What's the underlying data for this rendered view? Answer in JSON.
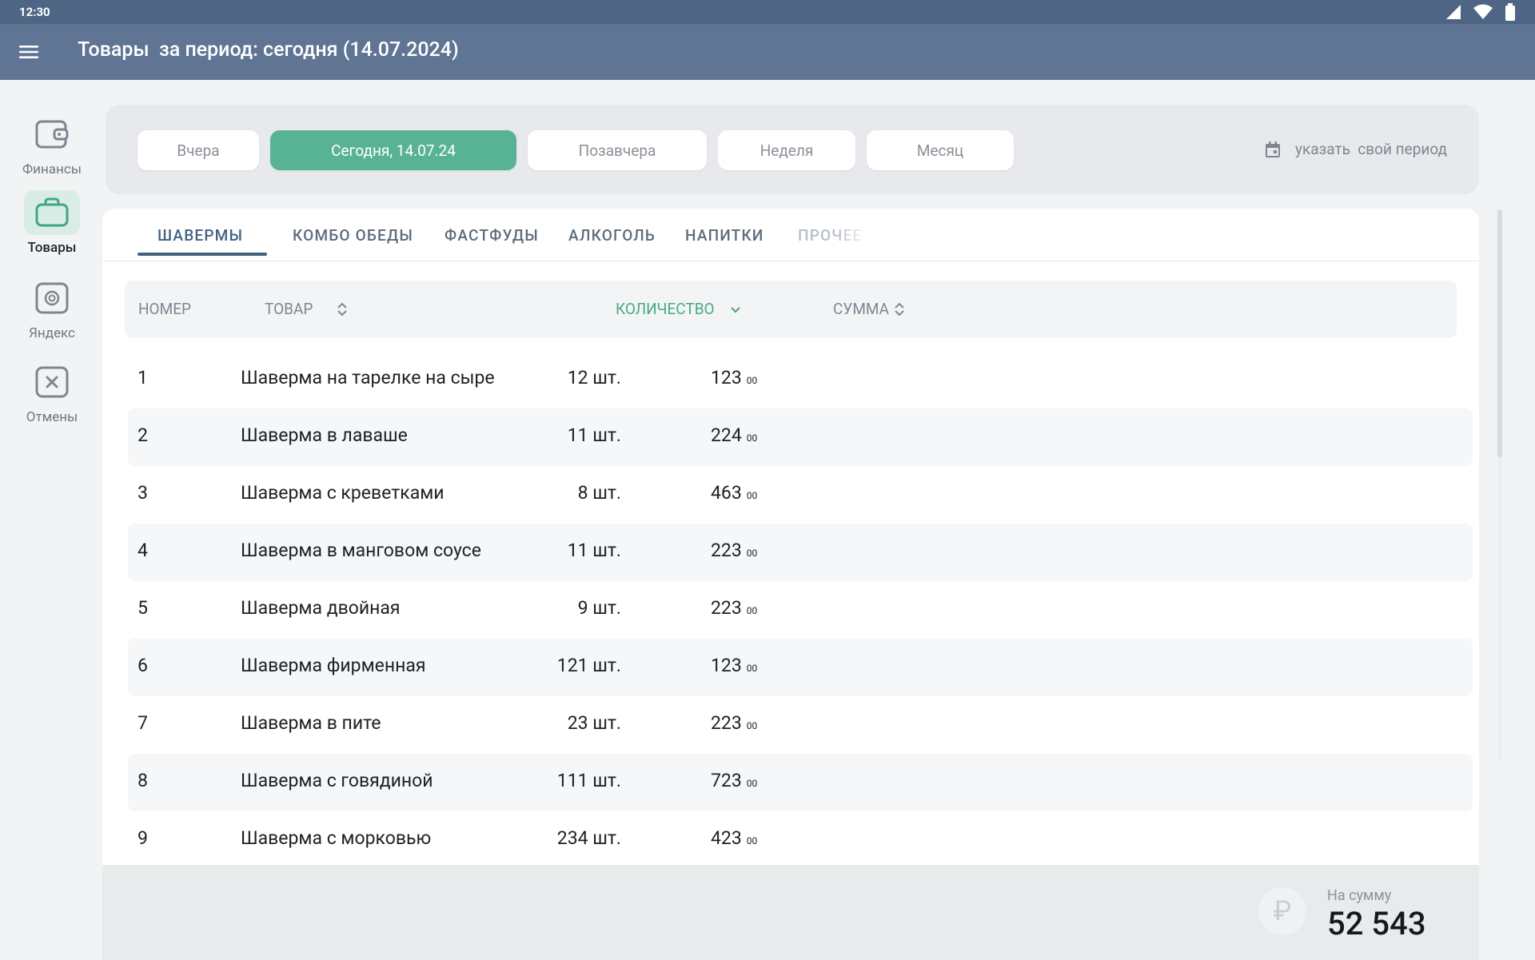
{
  "status": {
    "time": "12:30"
  },
  "appbar": {
    "title": "Товары  за период: сегодня (14.07.2024)"
  },
  "rail": {
    "items": [
      {
        "label": "Финансы",
        "icon": "wallet-icon"
      },
      {
        "label": "Товары",
        "icon": "bag-icon",
        "active": true
      },
      {
        "label": "Яндекс",
        "icon": "yandex-icon"
      },
      {
        "label": "Отмены",
        "icon": "cancel-icon"
      }
    ]
  },
  "period": {
    "chips": [
      "Вчера",
      "Сегодня, 14.07.24",
      "Позавчера",
      "Неделя",
      "Месяц"
    ],
    "active_chip": "Сегодня, 14.07.24",
    "custom": "указать  свой период"
  },
  "tabs": [
    "ШАВЕРМЫ",
    "КОМБО ОБЕДЫ",
    "ФАСТФУДЫ",
    "АЛКОГОЛЬ",
    "НАПИТКИ",
    "ПРОЧЕЕ"
  ],
  "active_tab": "ШАВЕРМЫ",
  "table": {
    "headers": {
      "number": "НОМЕР",
      "product": "ТОВАР",
      "quantity": "КОЛИЧЕСТВО",
      "sum": "СУММА"
    },
    "rows": [
      {
        "num": "1",
        "name": "Шаверма на тарелке на сыре",
        "qty": "12 шт.",
        "sum": "123",
        "kop": "00"
      },
      {
        "num": "2",
        "name": "Шаверма в лаваше",
        "qty": "11 шт.",
        "sum": "224",
        "kop": "00"
      },
      {
        "num": "3",
        "name": "Шаверма с креветками",
        "qty": "8 шт.",
        "sum": "463",
        "kop": "00"
      },
      {
        "num": "4",
        "name": "Шаверма в манговом соусе",
        "qty": "11 шт.",
        "sum": "223",
        "kop": "00"
      },
      {
        "num": "5",
        "name": "Шаверма двойная",
        "qty": "9 шт.",
        "sum": "223",
        "kop": "00"
      },
      {
        "num": "6",
        "name": "Шаверма фирменная",
        "qty": "121 шт.",
        "sum": "123",
        "kop": "00"
      },
      {
        "num": "7",
        "name": "Шаверма в пите",
        "qty": "23 шт.",
        "sum": "223",
        "kop": "00"
      },
      {
        "num": "8",
        "name": "Шаверма с говядиной",
        "qty": "111 шт.",
        "sum": "723",
        "kop": "00"
      },
      {
        "num": "9",
        "name": "Шаверма с морковью",
        "qty": "234 шт.",
        "sum": "423",
        "kop": "00"
      }
    ]
  },
  "footer": {
    "label": "На сумму",
    "total": "52 543",
    "currency_symbol": "₽"
  }
}
